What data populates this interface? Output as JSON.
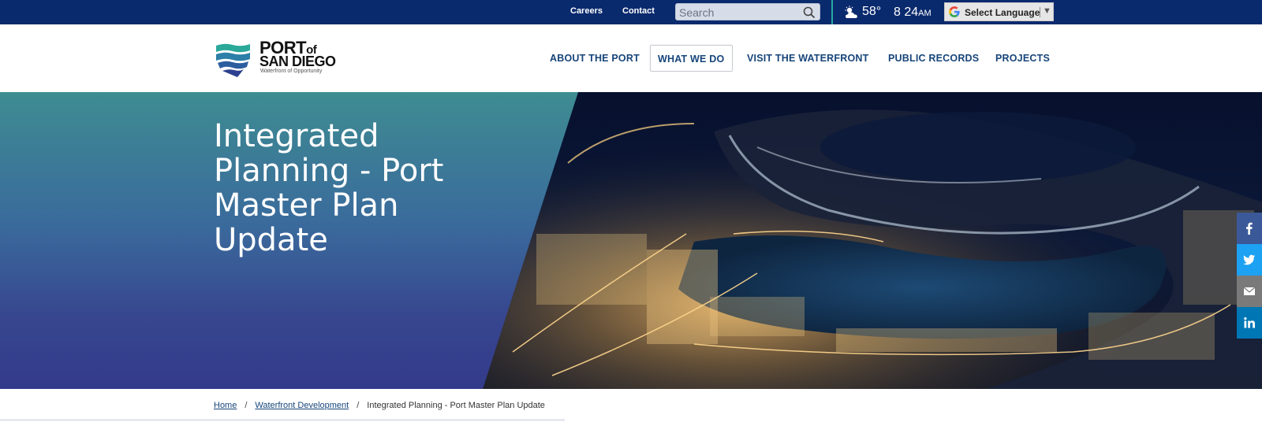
{
  "topbar": {
    "links": [
      "Careers",
      "Contact"
    ],
    "search_placeholder": "Search",
    "weather": {
      "icon": "partly-cloudy-icon",
      "temperature": "58°"
    },
    "time": {
      "value": "8 24",
      "meridiem": "AM"
    },
    "language_label": "Select Language",
    "language_arrow": "▼"
  },
  "logo": {
    "port": "PORT",
    "of": "of",
    "san_diego": "SAN DIEGO",
    "tagline": "Waterfront of Opportunity"
  },
  "nav": {
    "items": [
      "ABOUT THE PORT",
      "WHAT WE DO",
      "VISIT THE WATERFRONT",
      "PUBLIC RECORDS",
      "PROJECTS"
    ],
    "active": "WHAT WE DO"
  },
  "hero": {
    "title": "Integrated Planning - Port Master Plan Update"
  },
  "social": [
    {
      "icon": "facebook-icon",
      "color": "#3b5998"
    },
    {
      "icon": "twitter-icon",
      "color": "#1da1f2"
    },
    {
      "icon": "email-icon",
      "color": "#7a7a7a"
    },
    {
      "icon": "linkedin-icon",
      "color": "#0077b5"
    }
  ],
  "breadcrumb": {
    "items": [
      "Home",
      "Waterfront Development",
      "Integrated Planning - Port Master Plan Update"
    ],
    "separator": "/"
  },
  "colors": {
    "topbar": "#0a2a6e",
    "nav_text": "#17457a",
    "accent": "#27a9a0"
  }
}
